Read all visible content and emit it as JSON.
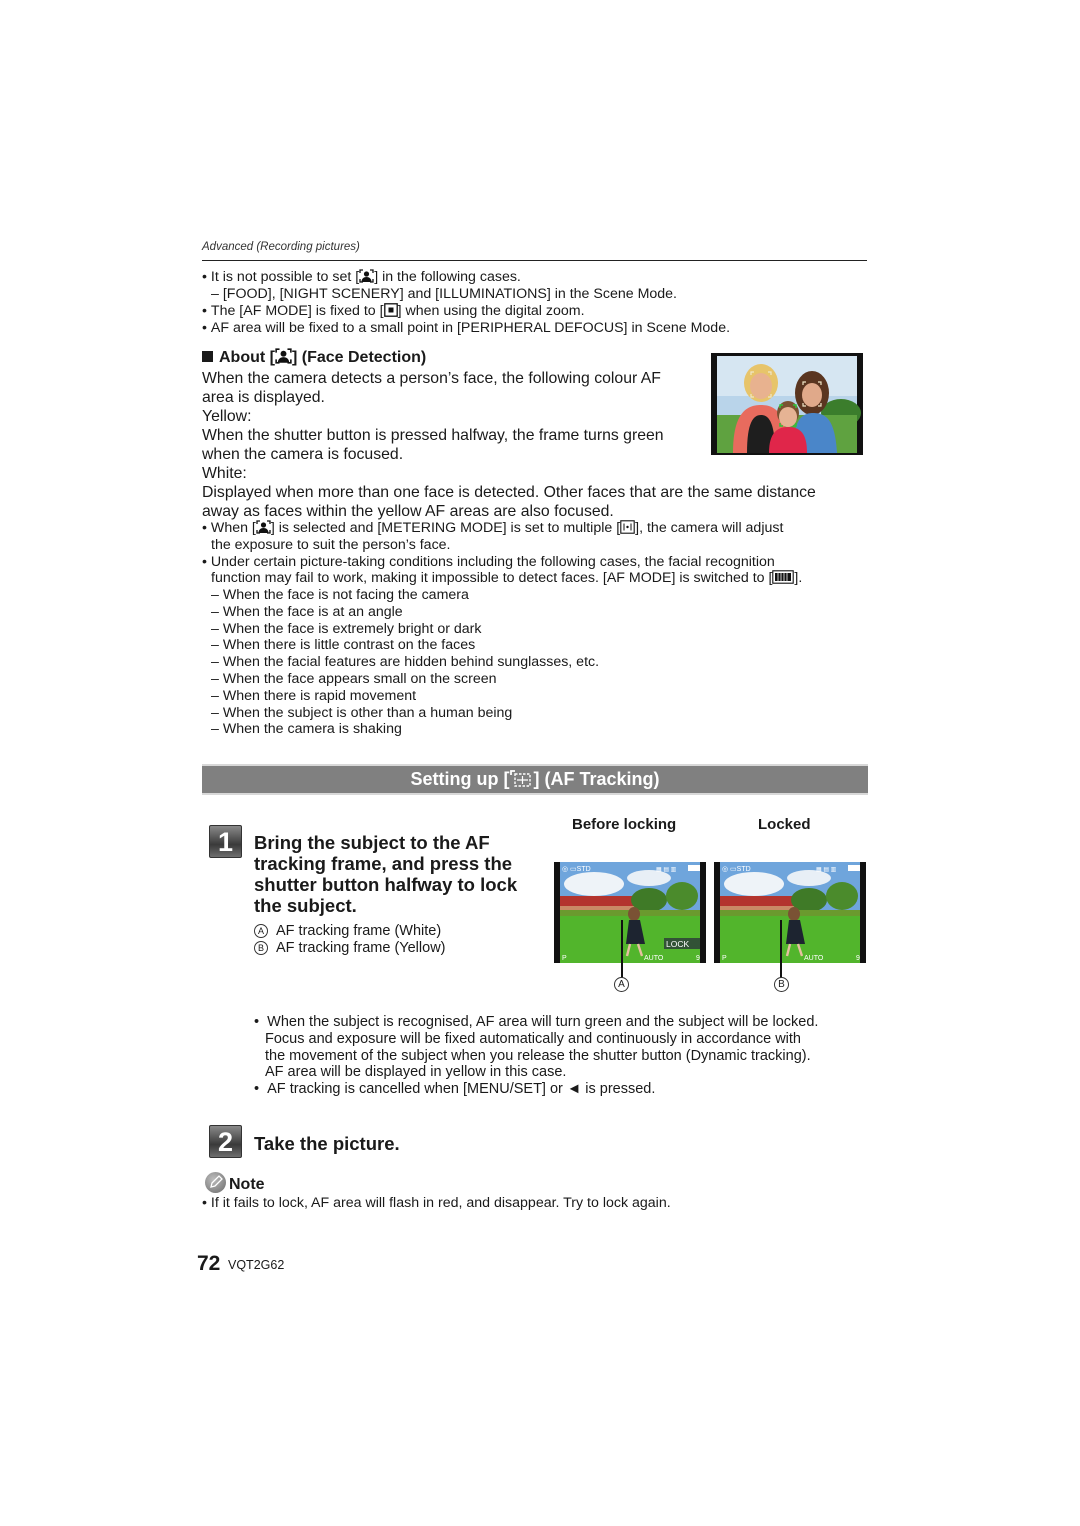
{
  "header": {
    "breadcrumb": "Advanced (Recording pictures)"
  },
  "intro_notes": [
    {
      "type": "bullet",
      "pre": "It is not possible to set [",
      "icon": "face-detection-icon",
      "post": "] in the following cases."
    },
    {
      "type": "dash",
      "text": "[FOOD], [NIGHT SCENERY] and [ILLUMINATIONS] in the Scene Mode."
    },
    {
      "type": "bullet",
      "pre": "The [AF MODE] is fixed to [",
      "icon": "1-area-focus-icon",
      "post": "] when using the digital zoom."
    },
    {
      "type": "bullet",
      "text": "AF area will be fixed to a small point in [PERIPHERAL DEFOCUS] in Scene Mode."
    }
  ],
  "face_detection": {
    "title_pre": "About [",
    "title_post": "] (Face Detection)",
    "paragraphs": [
      "When the camera detects a person’s face, the following colour AF",
      "area is displayed.",
      "Yellow:",
      "When the shutter button is pressed halfway, the frame turns green",
      "when the camera is focused.",
      "White:",
      "Displayed when more than one face is detected. Other faces that are the same distance",
      "away as faces within the yellow AF areas are also focused."
    ],
    "photo_alt": "Family photo with face detection frames",
    "notes": [
      {
        "pre": "When [",
        "icon": "face-detection-icon",
        "mid": "] is selected and [METERING MODE] is set to multiple [",
        "icon2": "multiple-metering-icon",
        "post": "], the camera will adjust",
        "cont": "the exposure to suit the person’s face."
      },
      {
        "line1": "Under certain picture-taking conditions including the following cases, the facial recognition",
        "line2_pre": "function may fail to work, making it impossible to detect faces. [AF MODE] is switched to [",
        "icon": "23-area-focus-icon",
        "line2_post": "]."
      }
    ],
    "cases": [
      "When the face is not facing the camera",
      "When the face is at an angle",
      "When the face is extremely bright or dark",
      "When there is little contrast on the faces",
      "When the facial features are hidden behind sunglasses, etc.",
      "When the face appears small on the screen",
      "When there is rapid movement",
      "When the subject is other than a human being",
      "When the camera is shaking"
    ]
  },
  "af_tracking": {
    "section_title_pre": "Setting up [",
    "section_title_post": "] (AF Tracking)",
    "step1": {
      "number": "1",
      "title_lines": [
        "Bring the subject to the AF",
        "tracking frame, and press the",
        "shutter button halfway to lock",
        "the subject."
      ],
      "legend": [
        {
          "marker": "A",
          "text": "AF tracking frame (White)"
        },
        {
          "marker": "B",
          "text": "AF tracking frame (Yellow)"
        }
      ]
    },
    "screens": [
      {
        "caption": "Before locking",
        "marker": "A",
        "lock_label": "LOCK",
        "mode": "P",
        "wb": "AUTO",
        "count": "9"
      },
      {
        "caption": "Locked",
        "marker": "B",
        "mode": "P",
        "wb": "AUTO",
        "count": "9"
      }
    ],
    "bullets": [
      [
        "When the subject is recognised, AF area will turn green and the subject will be locked.",
        "Focus and exposure will be fixed automatically and continuously in accordance with",
        "the movement of the subject when you release the shutter button (Dynamic tracking).",
        "AF area will be displayed in yellow in this case."
      ],
      [
        "AF tracking is cancelled when [MENU/SET] or ◄ is pressed."
      ]
    ],
    "step2": {
      "number": "2",
      "title": "Take the picture."
    }
  },
  "note": {
    "title": "Note",
    "items": [
      "If it fails to lock, AF area will flash in red, and disappear. Try to lock again."
    ]
  },
  "footer": {
    "page_number": "72",
    "model_code": "VQT2G62"
  }
}
